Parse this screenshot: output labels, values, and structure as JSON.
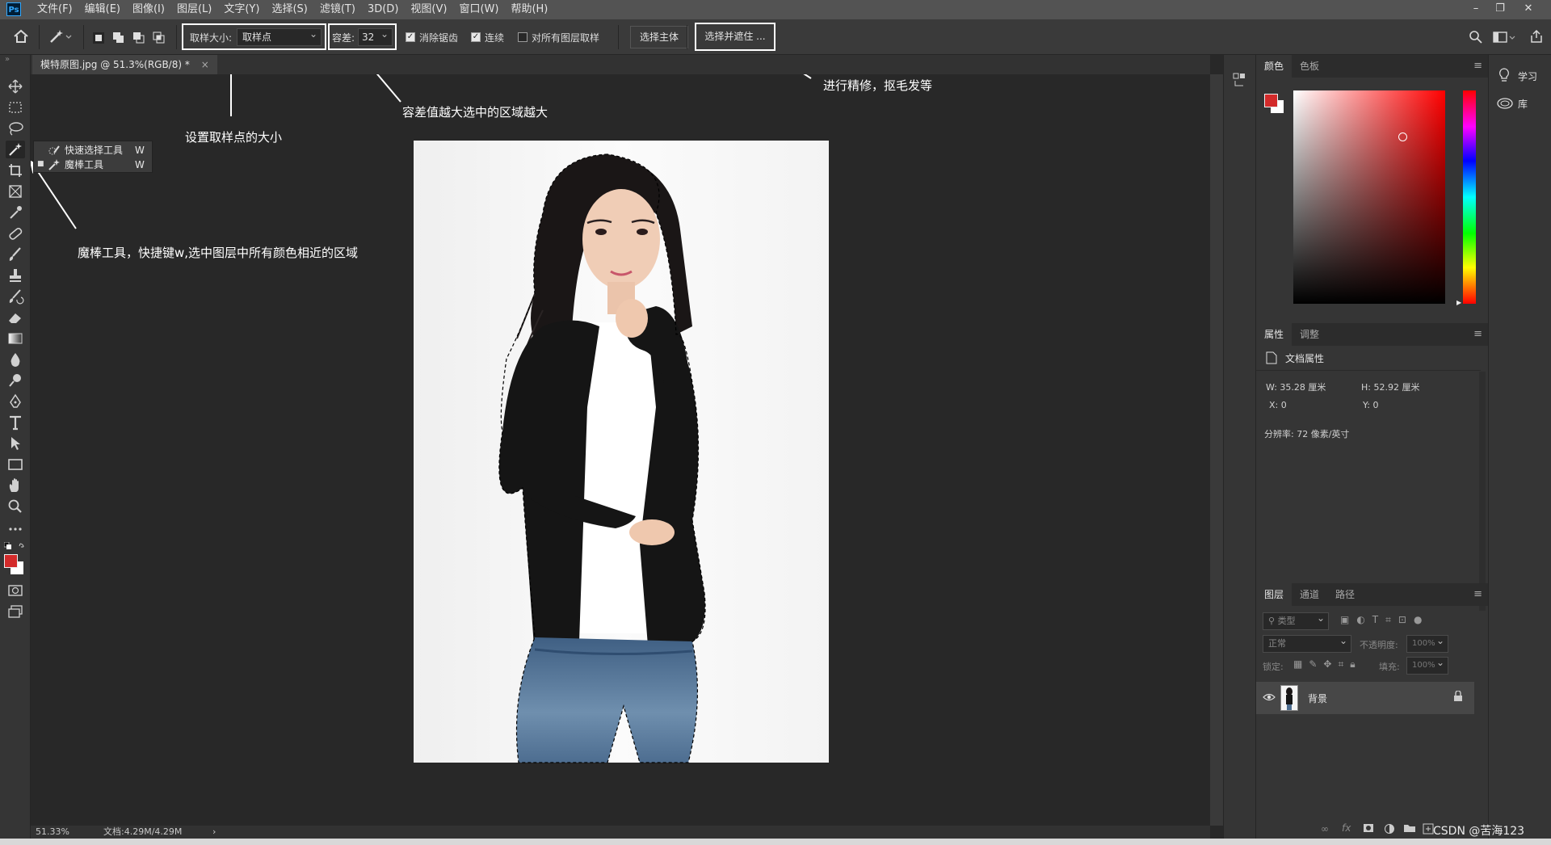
{
  "app": {
    "logo": "Ps"
  },
  "menu": [
    "文件(F)",
    "编辑(E)",
    "图像(I)",
    "图层(L)",
    "文字(Y)",
    "选择(S)",
    "滤镜(T)",
    "3D(D)",
    "视图(V)",
    "窗口(W)",
    "帮助(H)"
  ],
  "window_controls": {
    "minimize": "–",
    "restore": "❐",
    "close": "✕"
  },
  "options": {
    "sample_size_label": "取样大小:",
    "sample_size_value": "取样点",
    "tolerance_label": "容差:",
    "tolerance_value": "32",
    "anti_alias": {
      "label": "消除锯齿",
      "checked": true
    },
    "contiguous": {
      "label": "连续",
      "checked": true
    },
    "sample_all_layers": {
      "label": "对所有图层取样",
      "checked": false
    },
    "select_subject": "选择主体",
    "select_and_mask": "选择并遮住 ..."
  },
  "document": {
    "tab_title": "模特原图.jpg @ 51.3%(RGB/8) *",
    "close_glyph": "×",
    "zoom": "51.33%",
    "doc_size": "文档:4.29M/4.29M",
    "status_arrow": "›"
  },
  "tool_flyout": [
    {
      "label": "快速选择工具",
      "shortcut": "W"
    },
    {
      "label": "魔棒工具",
      "shortcut": "W"
    }
  ],
  "annotations": {
    "sample_size": "设置取样点的大小",
    "tolerance": "容差值越大选中的区域越大",
    "refine": "进行精修，抠毛发等",
    "magic_wand": "魔棒工具，快捷键w,选中图层中所有颜色相近的区域"
  },
  "panels": {
    "color_tabs": [
      "颜色",
      "色板"
    ],
    "properties_tabs": [
      "属性",
      "调整"
    ],
    "doc_props_title": "文档属性",
    "width": "W:  35.28  厘米",
    "height": "H:  52.92  厘米",
    "x": "X:  0",
    "y": "Y:  0",
    "resolution": "分辨率: 72 像素/英寸",
    "layers_tabs": [
      "图层",
      "通道",
      "路径"
    ],
    "layer_filter": "类型",
    "blend_mode": "正常",
    "opacity_label": "不透明度:",
    "opacity_value": "100%",
    "lock_label": "锁定:",
    "fill_label": "填充:",
    "fill_value": "100%",
    "layer_name": "背景",
    "bottom_icons": [
      "∞",
      "fx"
    ]
  },
  "right_dock": {
    "learn": "学习",
    "library": "库"
  },
  "watermark": "CSDN @苦海123",
  "colors": {
    "foreground": "#d32a2a",
    "background": "#ffffff",
    "hue": "#ff0000"
  }
}
